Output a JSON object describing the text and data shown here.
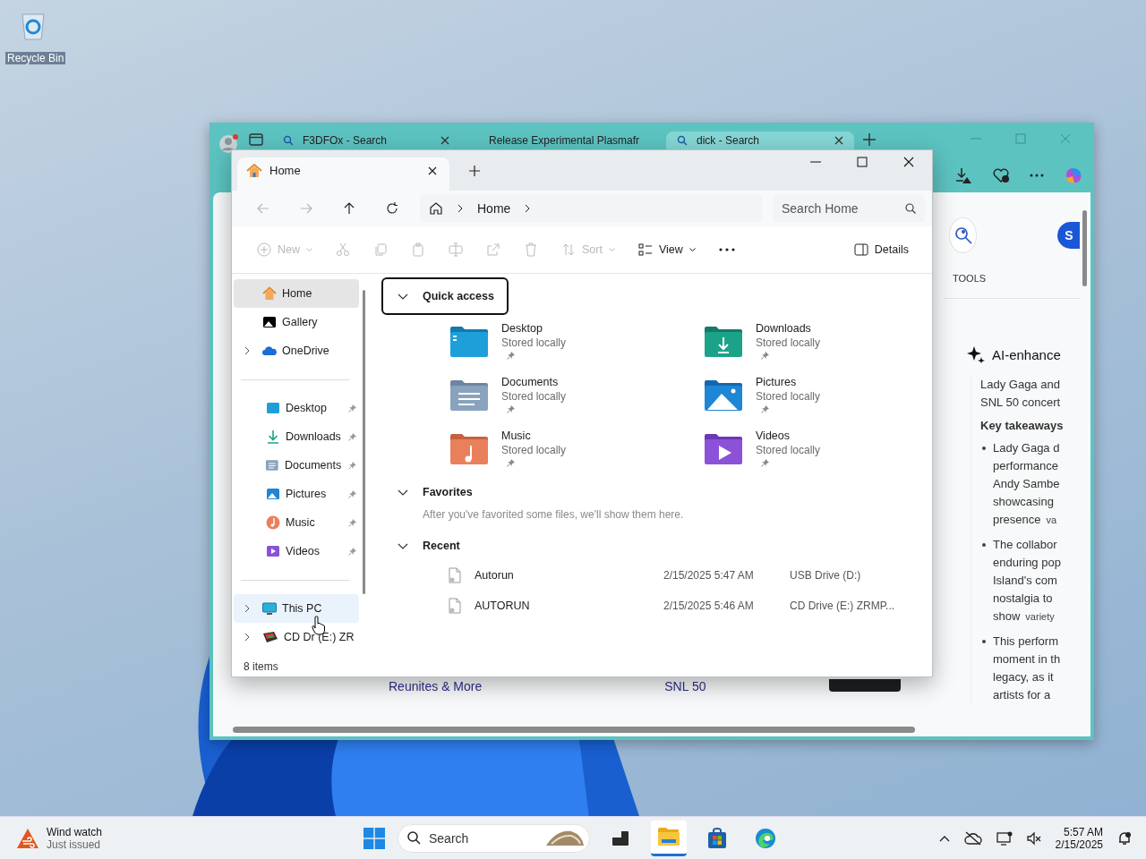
{
  "desktop": {
    "icons": [
      {
        "label": "Recycle Bin"
      }
    ]
  },
  "browser": {
    "tabs": [
      {
        "title": "F3DFOx - Search",
        "kind": "search",
        "selected": false
      },
      {
        "title": "Release Experimental Plasmafr",
        "kind": "github",
        "selected": false
      },
      {
        "title": "dick - Search",
        "kind": "search",
        "selected": true
      }
    ],
    "side_panel": {
      "account_initial": "S",
      "tools_label": "TOOLS",
      "heading": "AI-enhance",
      "intro": [
        "Lady Gaga and",
        "SNL 50 concert"
      ],
      "subheading": "Key takeaways",
      "bullets": [
        {
          "lines": [
            "Lady Gaga d",
            "performance",
            "Andy Sambe",
            "showcasing",
            "presence"
          ],
          "tag": "va"
        },
        {
          "lines": [
            "The collabor",
            "enduring pop",
            "Island's com",
            "nostalgia to",
            "show"
          ],
          "tag": "variety"
        },
        {
          "lines": [
            "This perform",
            "moment in th",
            "legacy, as it",
            "artists for a"
          ]
        }
      ]
    },
    "page_links": [
      "Reunites & More",
      "SNL 50"
    ]
  },
  "explorer": {
    "tabs": [
      {
        "title": "Home",
        "selected": true
      }
    ],
    "nav_buttons": [
      {
        "kind": "back",
        "disabled": true
      },
      {
        "kind": "forward",
        "disabled": true
      },
      {
        "kind": "up",
        "disabled": false
      },
      {
        "kind": "refresh",
        "disabled": false
      }
    ],
    "breadcrumb": [
      "Home"
    ],
    "search": {
      "placeholder": "Search Home"
    },
    "toolbar": [
      {
        "kind": "new",
        "label": "New",
        "disabled": true,
        "dropdown": true
      },
      {
        "kind": "cut",
        "disabled": true
      },
      {
        "kind": "copy",
        "disabled": true
      },
      {
        "kind": "paste",
        "disabled": true
      },
      {
        "kind": "rename",
        "disabled": true
      },
      {
        "kind": "share",
        "disabled": true
      },
      {
        "kind": "delete",
        "disabled": true
      },
      {
        "kind": "sort",
        "label": "Sort",
        "disabled": true,
        "dropdown": true
      },
      {
        "kind": "view",
        "label": "View",
        "disabled": false,
        "dropdown": true
      },
      {
        "kind": "more",
        "disabled": false
      }
    ],
    "details_label": "Details",
    "sidebar": [
      [
        {
          "label": "Home",
          "kind": "home",
          "expandable": false,
          "pinned": false,
          "selected": true,
          "hovered": false
        },
        {
          "label": "Gallery",
          "kind": "gallery",
          "expandable": false,
          "pinned": false,
          "selected": false,
          "hovered": false
        },
        {
          "label": "OneDrive",
          "kind": "onedrive",
          "expandable": true,
          "pinned": false,
          "selected": false,
          "hovered": false
        }
      ],
      [
        {
          "label": "Desktop",
          "kind": "desktop",
          "expandable": false,
          "pinned": true,
          "selected": false,
          "hovered": false
        },
        {
          "label": "Downloads",
          "kind": "downloads",
          "expandable": false,
          "pinned": true,
          "selected": false,
          "hovered": false
        },
        {
          "label": "Documents",
          "kind": "documents",
          "expandable": false,
          "pinned": true,
          "selected": false,
          "hovered": false
        },
        {
          "label": "Pictures",
          "kind": "pictures",
          "expandable": false,
          "pinned": true,
          "selected": false,
          "hovered": false
        },
        {
          "label": "Music",
          "kind": "music",
          "expandable": false,
          "pinned": true,
          "selected": false,
          "hovered": false
        },
        {
          "label": "Videos",
          "kind": "videos",
          "expandable": false,
          "pinned": true,
          "selected": false,
          "hovered": false
        }
      ],
      [
        {
          "label": "This PC",
          "kind": "pc",
          "expandable": true,
          "pinned": false,
          "selected": false,
          "hovered": true
        },
        {
          "label": "CD Dr (E:) ZR",
          "kind": "cd",
          "expandable": true,
          "pinned": false,
          "selected": false,
          "hovered": false
        }
      ]
    ],
    "quick_access": {
      "title": "Quick access",
      "expanded": true,
      "focused": true,
      "items": [
        {
          "name": "Desktop",
          "status": "Stored locally",
          "kind": "desktop",
          "pinned": true
        },
        {
          "name": "Downloads",
          "status": "Stored locally",
          "kind": "downloads",
          "pinned": true
        },
        {
          "name": "Documents",
          "status": "Stored locally",
          "kind": "documents",
          "pinned": true
        },
        {
          "name": "Pictures",
          "status": "Stored locally",
          "kind": "pictures",
          "pinned": true
        },
        {
          "name": "Music",
          "status": "Stored locally",
          "kind": "music",
          "pinned": true
        },
        {
          "name": "Videos",
          "status": "Stored locally",
          "kind": "videos",
          "pinned": true
        }
      ]
    },
    "favorites": {
      "title": "Favorites",
      "expanded": true,
      "message": "After you've favorited some files, we'll show them here."
    },
    "recent": {
      "title": "Recent",
      "expanded": true,
      "files": [
        {
          "name": "Autorun",
          "modified": "2/15/2025 5:47 AM",
          "location": "USB Drive (D:)"
        },
        {
          "name": "AUTORUN",
          "modified": "2/15/2025 5:46 AM",
          "location": "CD Drive (E:) ZRMP..."
        }
      ]
    },
    "status": "8 items"
  },
  "taskbar": {
    "widget": {
      "title": "Wind watch",
      "subtitle": "Just issued"
    },
    "search": {
      "placeholder": "Search"
    },
    "apps": [
      {
        "kind": "taskview",
        "active": false
      },
      {
        "kind": "explorer",
        "active": true
      },
      {
        "kind": "store",
        "active": false
      },
      {
        "kind": "edge",
        "active": false
      }
    ],
    "time": "5:57 AM",
    "date": "2/15/2025"
  }
}
